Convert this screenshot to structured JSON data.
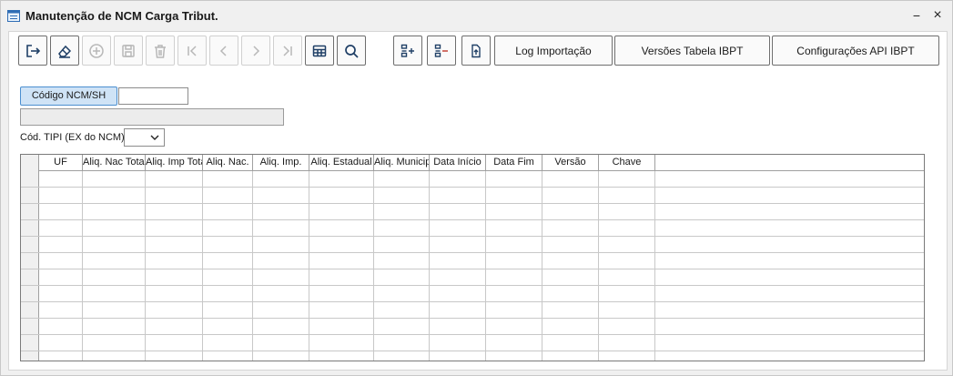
{
  "window": {
    "title": "Manutenção de NCM Carga Tribut.",
    "minimize_label": "−",
    "close_label": "×"
  },
  "toolbar": {
    "icon_buttons": [
      {
        "name": "exit-button",
        "icon": "exit-icon",
        "enabled": true
      },
      {
        "name": "clear-button",
        "icon": "eraser-icon",
        "enabled": true
      },
      {
        "name": "add-button",
        "icon": "plus-circle-icon",
        "enabled": false
      },
      {
        "name": "save-button",
        "icon": "save-icon",
        "enabled": false
      },
      {
        "name": "delete-button",
        "icon": "trash-icon",
        "enabled": false
      },
      {
        "name": "first-button",
        "icon": "first-icon",
        "enabled": false
      },
      {
        "name": "previous-button",
        "icon": "previous-icon",
        "enabled": false
      },
      {
        "name": "next-button",
        "icon": "next-icon",
        "enabled": false
      },
      {
        "name": "last-button",
        "icon": "last-icon",
        "enabled": false
      },
      {
        "name": "table-button",
        "icon": "table-icon",
        "enabled": true
      },
      {
        "name": "search-button",
        "icon": "search-icon",
        "enabled": true
      },
      {
        "name": "list-add-button",
        "icon": "list-add-icon",
        "enabled": true
      },
      {
        "name": "list-remove-button",
        "icon": "list-remove-icon",
        "enabled": true
      },
      {
        "name": "import-file-button",
        "icon": "file-upload-icon",
        "enabled": true
      }
    ],
    "log_label": "Log Importação",
    "versions_label": "Versões Tabela IBPT",
    "config_label": "Configurações API IBPT"
  },
  "form": {
    "code_label": "Código NCM/SH",
    "code_value": "",
    "description_value": "",
    "tipi_label": "Cód. TIPI (EX do NCM)",
    "tipi_value": ""
  },
  "grid": {
    "columns": [
      "UF",
      "Aliq. Nac Total",
      "Aliq. Imp Total",
      "Aliq. Nac.",
      "Aliq. Imp.",
      "Aliq. Estadual",
      "Aliq. Municipal",
      "Data Início",
      "Data Fim",
      "Versão",
      "Chave"
    ],
    "rows": []
  },
  "colors": {
    "accent": "#4b8fd0",
    "accent_fill": "#cfe3f6",
    "icon_active": "#1f3f66",
    "icon_disabled": "#b8b8b8"
  }
}
